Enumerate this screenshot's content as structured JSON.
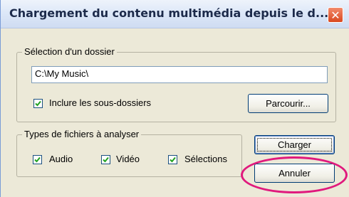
{
  "window": {
    "title": "Chargement du contenu multimédia depuis le d...",
    "close_label": "✕"
  },
  "folder_group": {
    "title": "Sélection d'un dossier",
    "path_value": "C:\\My Music\\",
    "include_subfolders_label": "Inclure les sous-dossiers",
    "include_subfolders_checked": true,
    "browse_label": "Parcourir..."
  },
  "types_group": {
    "title": "Types de fichiers à analyser",
    "options": [
      {
        "label": "Audio",
        "checked": true
      },
      {
        "label": "Vidéo",
        "checked": true
      },
      {
        "label": "Sélections",
        "checked": true
      }
    ]
  },
  "actions": {
    "load_label": "Charger",
    "cancel_label": "Annuler"
  },
  "colors": {
    "highlight": "#e0197d",
    "close_button": "#d9481f"
  }
}
